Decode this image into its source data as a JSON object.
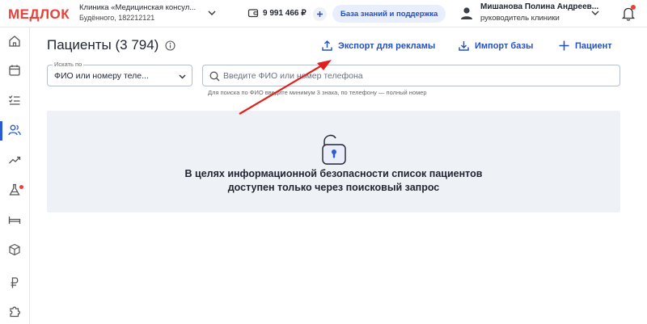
{
  "header": {
    "logo": "МЕДЛОК",
    "clinic_name": "Клиника «Медицинская консул...",
    "clinic_address": "Будённого, 182212121",
    "balance": "9 991 466 ₽",
    "kb_button": "База знаний и поддержка",
    "user_name": "Мишанова Полина Андреев...",
    "user_role": "руководитель клиники"
  },
  "page": {
    "title": "Пациенты (3 794)",
    "actions": {
      "export": "Экспорт для рекламы",
      "import": "Импорт базы",
      "add": "Пациент"
    }
  },
  "filter": {
    "search_by_label": "Искать по",
    "search_by_value": "ФИО или номеру теле...",
    "search_placeholder": "Введите ФИО или номер телефона",
    "hint": "Для поиска по ФИО введите минимум 3 знака, по телефону — полный номер"
  },
  "empty_state": {
    "line1": "В целях информационной безопасности список пациентов",
    "line2": "доступен только через поисковый запрос"
  },
  "colors": {
    "brand": "#e8413b",
    "accent": "#2050c8",
    "panel_bg": "#eef1f6",
    "annotation_arrow": "#e0201c"
  },
  "icons": {
    "sidebar": [
      "home-icon",
      "calendar-icon",
      "task-list-icon",
      "patients-icon",
      "analytics-icon",
      "lab-flask-icon",
      "bed-icon",
      "box-icon",
      "ruble-icon",
      "puzzle-icon"
    ]
  }
}
